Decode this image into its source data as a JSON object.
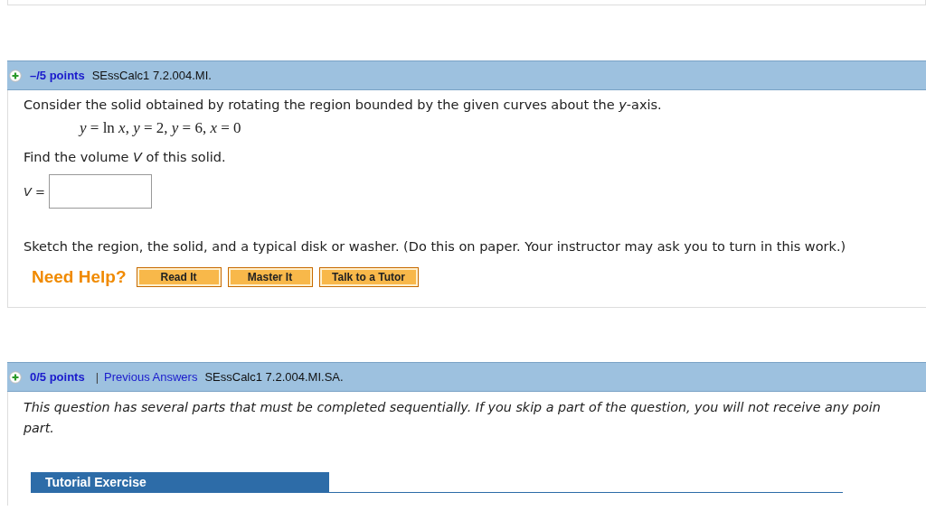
{
  "questions": [
    {
      "points": "–/5 points",
      "code": "SEssCalc1 7.2.004.MI.",
      "kind": "answer",
      "prompt": "Consider the solid obtained by rotating the region bounded by the given curves about the *y*-axis.",
      "equation": "*y* = ln *x*, *y* = 2, *y* = 6, *x* = 0",
      "find": "Find the volume *V* of this solid.",
      "answer_label": "*V* =",
      "sketch": "Sketch the region, the solid, and a typical disk or washer. (Do this on paper. Your instructor may ask you to turn in this work.)",
      "help_label": "Need Help?",
      "help_buttons": [
        "Read It",
        "Master It",
        "Talk to a Tutor"
      ]
    },
    {
      "points": "0/5 points",
      "separator": "|",
      "previous_answers": "Previous Answers",
      "code": "SEssCalc1 7.2.004.MI.SA.",
      "kind": "tutorial",
      "intro_lines": [
        "This question has several parts that must be completed sequentially. If you skip a part of the question, you will not receive any poin",
        "part."
      ],
      "section_title": "Tutorial Exercise"
    }
  ]
}
